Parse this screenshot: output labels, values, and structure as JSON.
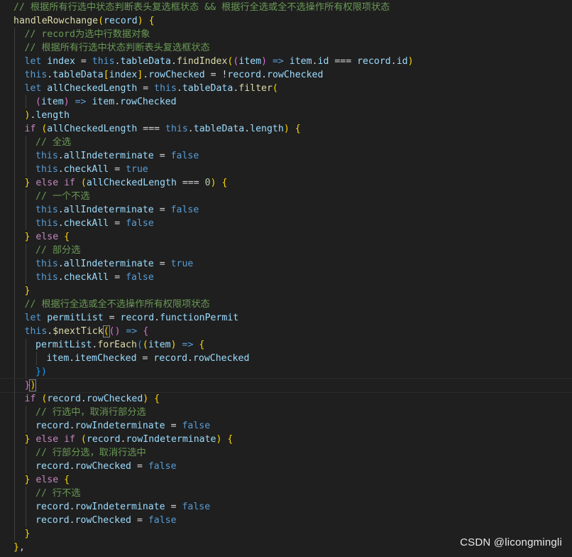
{
  "editor": {
    "language": "javascript",
    "lines": [
      {
        "indent": 0,
        "tokens": [
          {
            "t": "// 根据所有行选中状态判断表头复选框状态 && 根据行全选或全不选操作所有权限项状态",
            "c": "cm"
          }
        ]
      },
      {
        "indent": 0,
        "tokens": [
          {
            "t": "handleRowchange",
            "c": "fn"
          },
          {
            "t": "(",
            "c": "b1"
          },
          {
            "t": "record",
            "c": "vr"
          },
          {
            "t": ") {",
            "c": "b1"
          }
        ]
      },
      {
        "indent": 1,
        "tokens": [
          {
            "t": "// record为选中行数据对象",
            "c": "cm"
          }
        ]
      },
      {
        "indent": 1,
        "tokens": [
          {
            "t": "// 根据所有行选中状态判断表头复选框状态",
            "c": "cm"
          }
        ]
      },
      {
        "indent": 1,
        "tokens": [
          {
            "t": "let ",
            "c": "kw"
          },
          {
            "t": "index",
            "c": "vr"
          },
          {
            "t": " = ",
            "c": "pl"
          },
          {
            "t": "this",
            "c": "kw"
          },
          {
            "t": ".",
            "c": "pl"
          },
          {
            "t": "tableData",
            "c": "vr"
          },
          {
            "t": ".",
            "c": "pl"
          },
          {
            "t": "findIndex",
            "c": "fn"
          },
          {
            "t": "(",
            "c": "b1"
          },
          {
            "t": "(",
            "c": "b2"
          },
          {
            "t": "item",
            "c": "vr"
          },
          {
            "t": ")",
            "c": "b2"
          },
          {
            "t": " => ",
            "c": "kw"
          },
          {
            "t": "item",
            "c": "vr"
          },
          {
            "t": ".",
            "c": "pl"
          },
          {
            "t": "id",
            "c": "vr"
          },
          {
            "t": " === ",
            "c": "pl"
          },
          {
            "t": "record",
            "c": "vr"
          },
          {
            "t": ".",
            "c": "pl"
          },
          {
            "t": "id",
            "c": "vr"
          },
          {
            "t": ")",
            "c": "b1"
          }
        ]
      },
      {
        "indent": 1,
        "tokens": [
          {
            "t": "this",
            "c": "kw"
          },
          {
            "t": ".",
            "c": "pl"
          },
          {
            "t": "tableData",
            "c": "vr"
          },
          {
            "t": "[",
            "c": "b1"
          },
          {
            "t": "index",
            "c": "vr"
          },
          {
            "t": "]",
            "c": "b1"
          },
          {
            "t": ".",
            "c": "pl"
          },
          {
            "t": "rowChecked",
            "c": "vr"
          },
          {
            "t": " = !",
            "c": "pl"
          },
          {
            "t": "record",
            "c": "vr"
          },
          {
            "t": ".",
            "c": "pl"
          },
          {
            "t": "rowChecked",
            "c": "vr"
          }
        ]
      },
      {
        "indent": 1,
        "tokens": [
          {
            "t": "let ",
            "c": "kw"
          },
          {
            "t": "allCheckedLength",
            "c": "vr"
          },
          {
            "t": " = ",
            "c": "pl"
          },
          {
            "t": "this",
            "c": "kw"
          },
          {
            "t": ".",
            "c": "pl"
          },
          {
            "t": "tableData",
            "c": "vr"
          },
          {
            "t": ".",
            "c": "pl"
          },
          {
            "t": "filter",
            "c": "fn"
          },
          {
            "t": "(",
            "c": "b1"
          }
        ]
      },
      {
        "indent": 2,
        "tokens": [
          {
            "t": "(",
            "c": "b2"
          },
          {
            "t": "item",
            "c": "vr"
          },
          {
            "t": ")",
            "c": "b2"
          },
          {
            "t": " => ",
            "c": "kw"
          },
          {
            "t": "item",
            "c": "vr"
          },
          {
            "t": ".",
            "c": "pl"
          },
          {
            "t": "rowChecked",
            "c": "vr"
          }
        ]
      },
      {
        "indent": 1,
        "tokens": [
          {
            "t": ")",
            "c": "b1"
          },
          {
            "t": ".",
            "c": "pl"
          },
          {
            "t": "length",
            "c": "vr"
          }
        ]
      },
      {
        "indent": 1,
        "tokens": [
          {
            "t": "if ",
            "c": "kw2"
          },
          {
            "t": "(",
            "c": "b1"
          },
          {
            "t": "allCheckedLength",
            "c": "vr"
          },
          {
            "t": " === ",
            "c": "pl"
          },
          {
            "t": "this",
            "c": "kw"
          },
          {
            "t": ".",
            "c": "pl"
          },
          {
            "t": "tableData",
            "c": "vr"
          },
          {
            "t": ".",
            "c": "pl"
          },
          {
            "t": "length",
            "c": "vr"
          },
          {
            "t": ") {",
            "c": "b1"
          }
        ]
      },
      {
        "indent": 2,
        "tokens": [
          {
            "t": "// 全选",
            "c": "cm"
          }
        ]
      },
      {
        "indent": 2,
        "tokens": [
          {
            "t": "this",
            "c": "kw"
          },
          {
            "t": ".",
            "c": "pl"
          },
          {
            "t": "allIndeterminate",
            "c": "vr"
          },
          {
            "t": " = ",
            "c": "pl"
          },
          {
            "t": "false",
            "c": "kw"
          }
        ]
      },
      {
        "indent": 2,
        "tokens": [
          {
            "t": "this",
            "c": "kw"
          },
          {
            "t": ".",
            "c": "pl"
          },
          {
            "t": "checkAll",
            "c": "vr"
          },
          {
            "t": " = ",
            "c": "pl"
          },
          {
            "t": "true",
            "c": "kw"
          }
        ]
      },
      {
        "indent": 1,
        "tokens": [
          {
            "t": "} ",
            "c": "b1"
          },
          {
            "t": "else if ",
            "c": "kw2"
          },
          {
            "t": "(",
            "c": "b1"
          },
          {
            "t": "allCheckedLength",
            "c": "vr"
          },
          {
            "t": " === ",
            "c": "pl"
          },
          {
            "t": "0",
            "c": "nm"
          },
          {
            "t": ") {",
            "c": "b1"
          }
        ]
      },
      {
        "indent": 2,
        "tokens": [
          {
            "t": "// 一个不选",
            "c": "cm"
          }
        ]
      },
      {
        "indent": 2,
        "tokens": [
          {
            "t": "this",
            "c": "kw"
          },
          {
            "t": ".",
            "c": "pl"
          },
          {
            "t": "allIndeterminate",
            "c": "vr"
          },
          {
            "t": " = ",
            "c": "pl"
          },
          {
            "t": "false",
            "c": "kw"
          }
        ]
      },
      {
        "indent": 2,
        "tokens": [
          {
            "t": "this",
            "c": "kw"
          },
          {
            "t": ".",
            "c": "pl"
          },
          {
            "t": "checkAll",
            "c": "vr"
          },
          {
            "t": " = ",
            "c": "pl"
          },
          {
            "t": "false",
            "c": "kw"
          }
        ]
      },
      {
        "indent": 1,
        "tokens": [
          {
            "t": "} ",
            "c": "b1"
          },
          {
            "t": "else ",
            "c": "kw2"
          },
          {
            "t": "{",
            "c": "b1"
          }
        ]
      },
      {
        "indent": 2,
        "tokens": [
          {
            "t": "// 部分选",
            "c": "cm"
          }
        ]
      },
      {
        "indent": 2,
        "tokens": [
          {
            "t": "this",
            "c": "kw"
          },
          {
            "t": ".",
            "c": "pl"
          },
          {
            "t": "allIndeterminate",
            "c": "vr"
          },
          {
            "t": " = ",
            "c": "pl"
          },
          {
            "t": "true",
            "c": "kw"
          }
        ]
      },
      {
        "indent": 2,
        "tokens": [
          {
            "t": "this",
            "c": "kw"
          },
          {
            "t": ".",
            "c": "pl"
          },
          {
            "t": "checkAll",
            "c": "vr"
          },
          {
            "t": " = ",
            "c": "pl"
          },
          {
            "t": "false",
            "c": "kw"
          }
        ]
      },
      {
        "indent": 1,
        "tokens": [
          {
            "t": "}",
            "c": "b1"
          }
        ]
      },
      {
        "indent": 1,
        "tokens": [
          {
            "t": "// 根据行全选或全不选操作所有权限项状态",
            "c": "cm"
          }
        ]
      },
      {
        "indent": 1,
        "tokens": [
          {
            "t": "let ",
            "c": "kw"
          },
          {
            "t": "permitList",
            "c": "vr"
          },
          {
            "t": " = ",
            "c": "pl"
          },
          {
            "t": "record",
            "c": "vr"
          },
          {
            "t": ".",
            "c": "pl"
          },
          {
            "t": "functionPermit",
            "c": "vr"
          }
        ]
      },
      {
        "indent": 1,
        "tokens": [
          {
            "t": "this",
            "c": "kw"
          },
          {
            "t": ".",
            "c": "pl"
          },
          {
            "t": "$nextTick",
            "c": "fn"
          },
          {
            "t": "(",
            "c": "b1",
            "m": true
          },
          {
            "t": "(",
            "c": "b2"
          },
          {
            "t": ")",
            "c": "b2"
          },
          {
            "t": " => ",
            "c": "kw"
          },
          {
            "t": "{",
            "c": "b2"
          }
        ]
      },
      {
        "indent": 2,
        "tokens": [
          {
            "t": "permitList",
            "c": "vr"
          },
          {
            "t": ".",
            "c": "pl"
          },
          {
            "t": "forEach",
            "c": "fn"
          },
          {
            "t": "(",
            "c": "b3"
          },
          {
            "t": "(",
            "c": "b1"
          },
          {
            "t": "item",
            "c": "vr"
          },
          {
            "t": ")",
            "c": "b1"
          },
          {
            "t": " => ",
            "c": "kw"
          },
          {
            "t": "{",
            "c": "b1"
          }
        ]
      },
      {
        "indent": 3,
        "tokens": [
          {
            "t": "item",
            "c": "vr"
          },
          {
            "t": ".",
            "c": "pl"
          },
          {
            "t": "itemChecked",
            "c": "vr"
          },
          {
            "t": " = ",
            "c": "pl"
          },
          {
            "t": "record",
            "c": "vr"
          },
          {
            "t": ".",
            "c": "pl"
          },
          {
            "t": "rowChecked",
            "c": "vr"
          }
        ]
      },
      {
        "indent": 2,
        "tokens": [
          {
            "t": "})",
            "c": "b3"
          }
        ]
      },
      {
        "indent": 1,
        "current": true,
        "tokens": [
          {
            "t": "}",
            "c": "b2"
          },
          {
            "t": ")",
            "c": "b1",
            "m": true
          }
        ]
      },
      {
        "indent": 1,
        "tokens": [
          {
            "t": "if ",
            "c": "kw2"
          },
          {
            "t": "(",
            "c": "b1"
          },
          {
            "t": "record",
            "c": "vr"
          },
          {
            "t": ".",
            "c": "pl"
          },
          {
            "t": "rowChecked",
            "c": "vr"
          },
          {
            "t": ") {",
            "c": "b1"
          }
        ]
      },
      {
        "indent": 2,
        "tokens": [
          {
            "t": "// 行选中，取消行部分选",
            "c": "cm"
          }
        ]
      },
      {
        "indent": 2,
        "tokens": [
          {
            "t": "record",
            "c": "vr"
          },
          {
            "t": ".",
            "c": "pl"
          },
          {
            "t": "rowIndeterminate",
            "c": "vr"
          },
          {
            "t": " = ",
            "c": "pl"
          },
          {
            "t": "false",
            "c": "kw"
          }
        ]
      },
      {
        "indent": 1,
        "tokens": [
          {
            "t": "} ",
            "c": "b1"
          },
          {
            "t": "else if ",
            "c": "kw2"
          },
          {
            "t": "(",
            "c": "b1"
          },
          {
            "t": "record",
            "c": "vr"
          },
          {
            "t": ".",
            "c": "pl"
          },
          {
            "t": "rowIndeterminate",
            "c": "vr"
          },
          {
            "t": ") {",
            "c": "b1"
          }
        ]
      },
      {
        "indent": 2,
        "tokens": [
          {
            "t": "// 行部分选，取消行选中",
            "c": "cm"
          }
        ]
      },
      {
        "indent": 2,
        "tokens": [
          {
            "t": "record",
            "c": "vr"
          },
          {
            "t": ".",
            "c": "pl"
          },
          {
            "t": "rowChecked",
            "c": "vr"
          },
          {
            "t": " = ",
            "c": "pl"
          },
          {
            "t": "false",
            "c": "kw"
          }
        ]
      },
      {
        "indent": 1,
        "tokens": [
          {
            "t": "} ",
            "c": "b1"
          },
          {
            "t": "else ",
            "c": "kw2"
          },
          {
            "t": "{",
            "c": "b1"
          }
        ]
      },
      {
        "indent": 2,
        "tokens": [
          {
            "t": "// 行不选",
            "c": "cm"
          }
        ]
      },
      {
        "indent": 2,
        "tokens": [
          {
            "t": "record",
            "c": "vr"
          },
          {
            "t": ".",
            "c": "pl"
          },
          {
            "t": "rowIndeterminate",
            "c": "vr"
          },
          {
            "t": " = ",
            "c": "pl"
          },
          {
            "t": "false",
            "c": "kw"
          }
        ]
      },
      {
        "indent": 2,
        "tokens": [
          {
            "t": "record",
            "c": "vr"
          },
          {
            "t": ".",
            "c": "pl"
          },
          {
            "t": "rowChecked",
            "c": "vr"
          },
          {
            "t": " = ",
            "c": "pl"
          },
          {
            "t": "false",
            "c": "kw"
          }
        ]
      },
      {
        "indent": 1,
        "tokens": [
          {
            "t": "}",
            "c": "b1"
          }
        ]
      },
      {
        "indent": 0,
        "tokens": [
          {
            "t": "}",
            "c": "b1"
          },
          {
            "t": ",",
            "c": "pl"
          }
        ]
      }
    ]
  },
  "watermark": "CSDN @licongmingli"
}
